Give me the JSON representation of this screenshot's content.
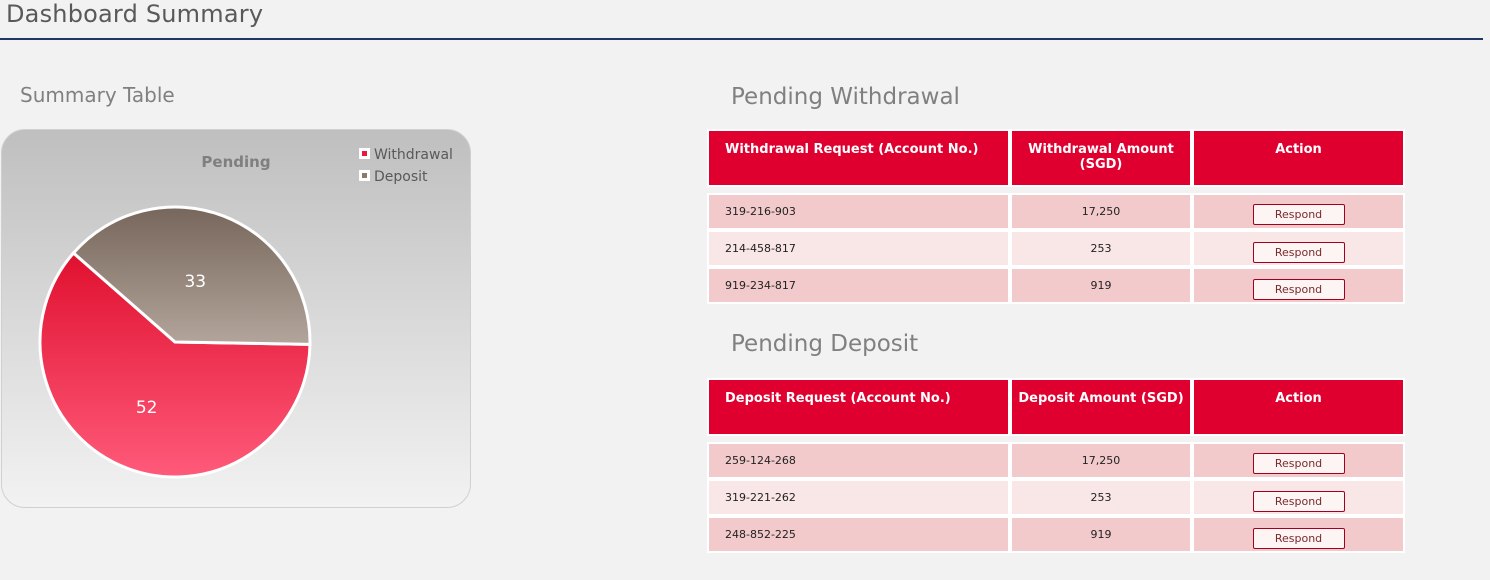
{
  "header": {
    "title": "Dashboard Summary"
  },
  "summary": {
    "title": "Summary Table",
    "chart_data": {
      "type": "pie",
      "title": "Pending",
      "series": [
        {
          "name": "Withdrawal",
          "value": 52,
          "color": "#e8183f"
        },
        {
          "name": "Deposit",
          "value": 33,
          "color": "#8a7a70"
        }
      ],
      "legend": "top-right"
    }
  },
  "withdrawal": {
    "title": "Pending Withdrawal",
    "headers": [
      "Withdrawal Request (Account No.)",
      "Withdrawal Amount (SGD)",
      "Action"
    ],
    "rows": [
      {
        "account": "319-216-903",
        "amount": "17,250",
        "action": "Respond"
      },
      {
        "account": "214-458-817",
        "amount": "253",
        "action": "Respond"
      },
      {
        "account": "919-234-817",
        "amount": "919",
        "action": "Respond"
      }
    ]
  },
  "deposit": {
    "title": "Pending Deposit",
    "headers": [
      "Deposit Request (Account No.)",
      "Deposit Amount (SGD)",
      "Action"
    ],
    "rows": [
      {
        "account": "259-124-268",
        "amount": "17,250",
        "action": "Respond"
      },
      {
        "account": "319-221-262",
        "amount": "253",
        "action": "Respond"
      },
      {
        "account": "248-852-225",
        "amount": "919",
        "action": "Respond"
      }
    ]
  }
}
